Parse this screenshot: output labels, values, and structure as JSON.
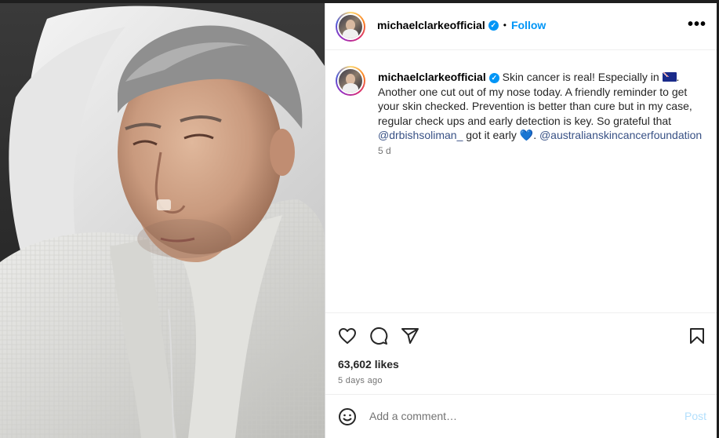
{
  "post": {
    "username": "michaelclarkeofficial",
    "follow_label": "Follow",
    "separator": "•",
    "more_label": "•••",
    "caption_part1": "Skin cancer is real! Especially in ",
    "caption_part2": ". Another one cut out of my nose today. A friendly reminder to get your skin checked. Prevention is better than cure but in my case, regular check ups and early detection is key. So grateful that ",
    "mention1": "@drbishsoliman_",
    "caption_part3": " got it early ",
    "heart": "💙",
    "caption_part4": ". ",
    "mention2": "@australianskincancerfoundation",
    "caption_age": "5 d",
    "likes": "63,602 likes",
    "time_ago": "5 days ago",
    "comment_placeholder": "Add a comment…",
    "post_label": "Post"
  },
  "icons": {
    "verified": "verified-badge-icon",
    "like": "heart-icon",
    "comment": "comment-bubble-icon",
    "share": "paper-plane-icon",
    "save": "bookmark-icon",
    "emoji": "smiley-icon",
    "flag": "australia-flag-icon"
  },
  "colors": {
    "accent": "#0095f6",
    "mention": "#385185",
    "muted": "#737373"
  }
}
